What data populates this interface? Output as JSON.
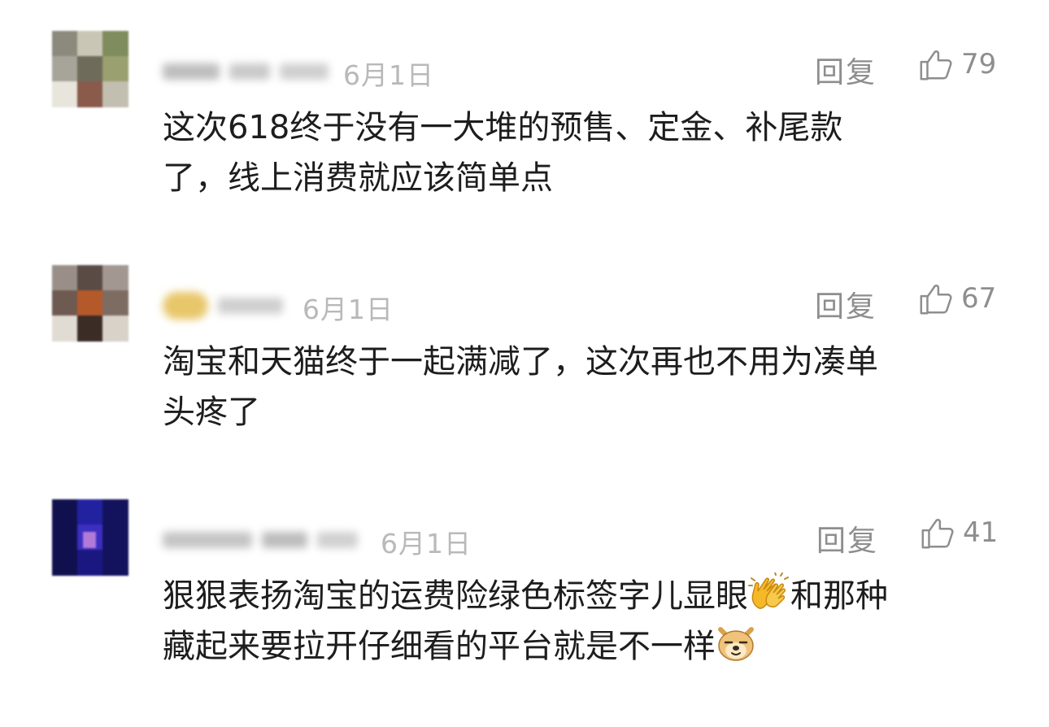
{
  "comments": [
    {
      "date": "6月1日",
      "reply_label": "回复",
      "like_count": "79",
      "line1": "这次618终于没有一大堆的预售、定金、补尾款",
      "line2": "了，线上消费就应该简单点"
    },
    {
      "date": "6月1日",
      "reply_label": "回复",
      "like_count": "67",
      "line1": "淘宝和天猫终于一起满减了，这次再也不用为凑单",
      "line2": "头疼了"
    },
    {
      "date": "6月1日",
      "reply_label": "回复",
      "like_count": "41",
      "line1a": "狠狠表扬淘宝的运费险绿色标签字儿显眼",
      "emoji1": "clapping-hands",
      "line1b": "和那种",
      "line2a": "藏起来要拉开仔细看的平台就是不一样",
      "emoji2": "doge"
    }
  ],
  "colors": {
    "text": "#1d1d1d",
    "secondary": "#8e8e8e",
    "date": "#b9b9b9",
    "background": "#ffffff"
  }
}
